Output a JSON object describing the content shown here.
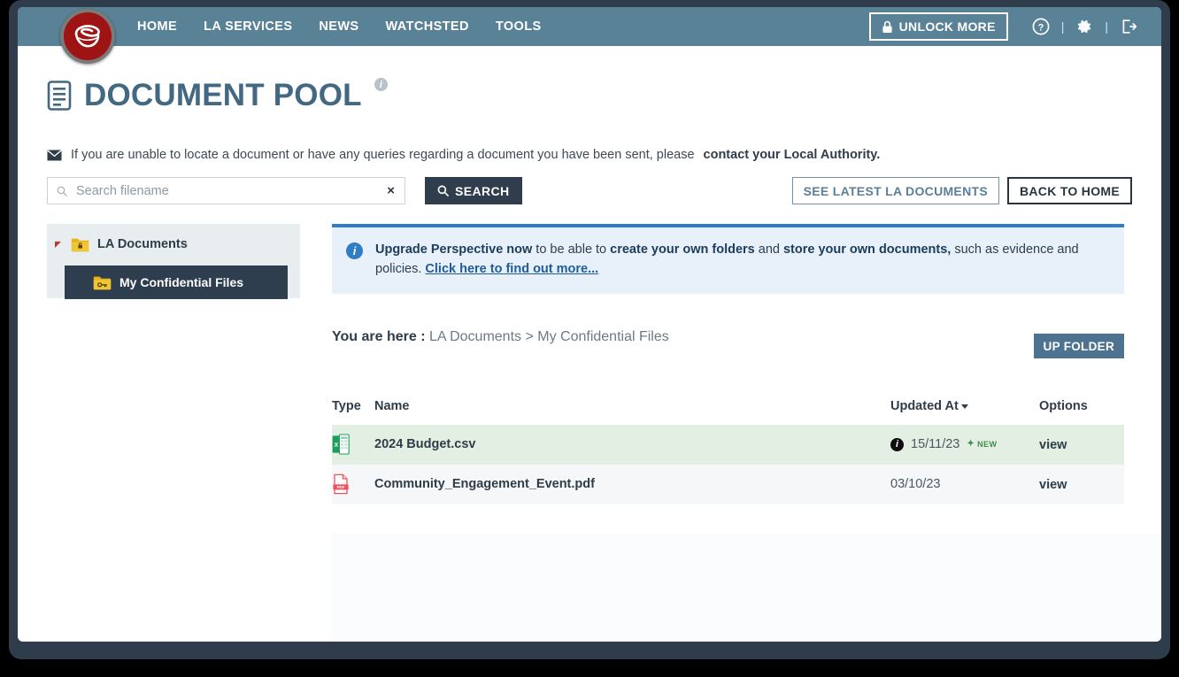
{
  "header": {
    "logo_icon": "company-swirl-logo",
    "nav": [
      {
        "label": "HOME"
      },
      {
        "label": "LA SERVICES"
      },
      {
        "label": "NEWS"
      },
      {
        "label": "WATCHSTED"
      },
      {
        "label": "TOOLS"
      }
    ],
    "unlock_label": "UNLOCK MORE",
    "unlock_icon": "lock-icon",
    "help_icon": "help-circle-icon",
    "settings_icon": "gear-icon",
    "logout_icon": "logout-icon",
    "separator": "|",
    "nav_bg": "#5a8296",
    "logo_color": "#9e1414"
  },
  "page": {
    "title": "DOCUMENT POOL",
    "title_icon": "document-list-icon",
    "info_badge": "i",
    "notice_icon": "envelope-icon",
    "notice_text": "If you are unable to locate a document or have any queries regarding a document you have been sent, please ",
    "notice_bold": "contact your Local Authority.",
    "title_color": "#426882"
  },
  "search": {
    "icon": "search-icon",
    "placeholder": "Search filename",
    "value": "",
    "clear_label": "×",
    "button_label": "SEARCH",
    "button_icon": "search-icon"
  },
  "actions": {
    "see_latest_label": "SEE LATEST LA DOCUMENTS",
    "back_home_label": "BACK TO HOME"
  },
  "sidebar": {
    "root": {
      "label": "LA Documents",
      "icon": "folder-lock-icon",
      "caret": "collapse-caret"
    },
    "children": [
      {
        "label": "My Confidential Files",
        "icon": "folder-key-icon",
        "selected": true
      }
    ]
  },
  "alert": {
    "icon": "info-icon",
    "bold1": "Upgrade Perspective now",
    "text1": " to be able to ",
    "bold2": "create your own folders",
    "text2": " and ",
    "bold3": "store your own documents,",
    "text3": " such as evidence and policies. ",
    "link": "Click here to find out more...",
    "accent": "#2f7dc4"
  },
  "breadcrumb": {
    "label": "You are here :",
    "path": " LA Documents > My Confidential Files"
  },
  "toolbar": {
    "up_folder_label": "UP FOLDER"
  },
  "table": {
    "columns": [
      "Type",
      "Name",
      "Updated At",
      "Options"
    ],
    "sort_column": "Updated At",
    "sort_icon": "caret-down-icon",
    "rows": [
      {
        "type_icon": "excel-file-icon",
        "name": "2024 Budget.csv",
        "has_info": true,
        "info_badge": "i",
        "updated_at": "15/11/23",
        "badge": "NEW",
        "badge_icon": "star-icon",
        "option": "view",
        "highlight": true
      },
      {
        "type_icon": "pdf-file-icon",
        "name": "Community_Engagement_Event.pdf",
        "has_info": false,
        "info_badge": "",
        "updated_at": "03/10/23",
        "badge": "",
        "badge_icon": "",
        "option": "view",
        "highlight": false
      }
    ]
  }
}
